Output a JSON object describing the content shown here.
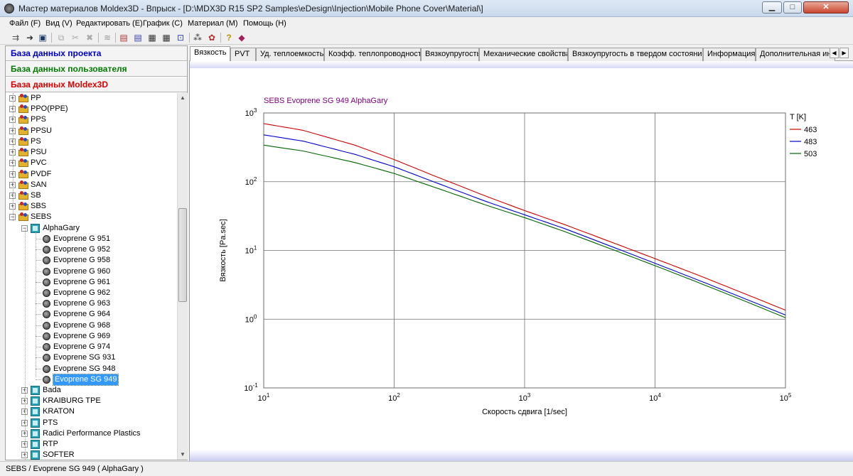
{
  "window": {
    "title": "Мастер материалов Moldex3D - Впрыск - [D:\\MDX3D R15 SP2 Samples\\eDesign\\Injection\\Mobile Phone Cover\\Material\\]",
    "minimize": "▁",
    "maximize": "□",
    "close": "✕"
  },
  "menu": [
    "Файл (F)",
    "Вид (V)",
    "Редактировать (E)",
    "График (C)",
    "Материал (M)",
    "Помощь (H)"
  ],
  "toolbar_icons": [
    "import-icon",
    "export-icon",
    "save-icon",
    "copy-icon",
    "cut-icon",
    "delete-icon",
    "compare-icon",
    "chart-icon",
    "chart-icon",
    "chart-icon",
    "chart-icon",
    "select-icon",
    "material-icon",
    "palette-icon",
    "help-icon",
    "book-icon"
  ],
  "databases": {
    "project": "База данных проекта",
    "user": "База данных пользователя",
    "moldex": "База данных Moldex3D",
    "project_color": "#0000cc",
    "user_color": "#007a00",
    "moldex_color": "#dd0000"
  },
  "tree": {
    "families": [
      "PP",
      "PPO(PPE)",
      "PPS",
      "PPSU",
      "PS",
      "PSU",
      "PVC",
      "PVDF",
      "SAN",
      "SB",
      "SBS",
      "SEBS"
    ],
    "open_supplier": "AlphaGary",
    "grades": [
      "Evoprene G 951",
      "Evoprene G 952",
      "Evoprene G 958",
      "Evoprene G 960",
      "Evoprene G 961",
      "Evoprene G 962",
      "Evoprene G 963",
      "Evoprene G 964",
      "Evoprene G 968",
      "Evoprene G 969",
      "Evoprene G 974",
      "Evoprene SG 931",
      "Evoprene SG 948",
      "Evoprene SG 949"
    ],
    "selected_grade": "Evoprene SG 949",
    "suppliers": [
      "Bada",
      "KRAIBURG TPE",
      "KRATON",
      "PTS",
      "Radici Performance Plastics",
      "RTP",
      "SOFTER"
    ]
  },
  "tabs": [
    "Вязкость",
    "PVT",
    "Уд. теплоемкость",
    "Коэфф. теплопроводности",
    "Вязкоупругость",
    "Механические свойства",
    "Вязкоупругость в твердом состоянии",
    "Информация",
    "Дополнительная инф"
  ],
  "active_tab": "Вязкость",
  "chart_data": {
    "type": "line",
    "title": "SEBS    Evoprene SG 949    AlphaGary",
    "xlabel": "Скорость сдвига [1/sec]",
    "ylabel": "Вязкость [Pa.sec]",
    "xscale": "log",
    "yscale": "log",
    "xlim": [
      10,
      100000
    ],
    "ylim": [
      0.1,
      1000
    ],
    "x_ticks": [
      10,
      100,
      1000,
      10000,
      100000
    ],
    "y_ticks": [
      0.1,
      1,
      10,
      100,
      1000
    ],
    "grid": true,
    "legend_title": "T [K]",
    "legend_position": "right",
    "series": [
      {
        "name": "463",
        "color": "#cc0000",
        "x": [
          10,
          20,
          50,
          100,
          200,
          500,
          1000,
          2000,
          5000,
          10000,
          20000,
          50000,
          100000
        ],
        "values": [
          700,
          560,
          340,
          210,
          123,
          62,
          38,
          24,
          12.5,
          7.6,
          4.6,
          2.3,
          1.35
        ]
      },
      {
        "name": "483",
        "color": "#0000cc",
        "x": [
          10,
          20,
          50,
          100,
          200,
          500,
          1000,
          2000,
          5000,
          10000,
          20000,
          50000,
          100000
        ],
        "values": [
          480,
          390,
          250,
          165,
          100,
          52,
          33,
          21,
          10.8,
          6.5,
          3.9,
          1.95,
          1.15
        ]
      },
      {
        "name": "503",
        "color": "#006600",
        "x": [
          10,
          20,
          50,
          100,
          200,
          500,
          1000,
          2000,
          5000,
          10000,
          20000,
          50000,
          100000
        ],
        "values": [
          340,
          280,
          190,
          132,
          84,
          46,
          30,
          19,
          9.9,
          6.0,
          3.6,
          1.8,
          1.05
        ]
      }
    ],
    "title_color": "#800080"
  },
  "status": "SEBS / Evoprene SG 949 ( AlphaGary )"
}
